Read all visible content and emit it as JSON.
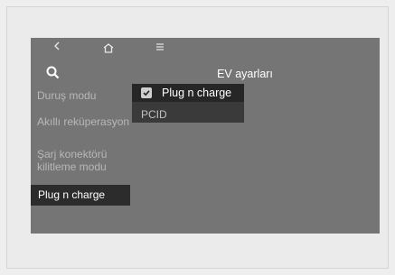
{
  "header": {
    "title": "EV ayarları"
  },
  "nav": {
    "icons": [
      "back-icon",
      "home-icon",
      "menu-icon",
      "search-icon"
    ]
  },
  "sidebar": {
    "items": [
      {
        "label": "Duruş modu",
        "selected": false
      },
      {
        "label": "Akıllı reküperasyon",
        "selected": false
      },
      {
        "label": "Şarj konektörü kilitleme modu",
        "selected": false
      },
      {
        "label": "Plug n charge",
        "selected": true
      }
    ]
  },
  "popup": {
    "checkbox_label": "Plug n charge",
    "checked": true,
    "pcid_label": "PCID"
  },
  "colors": {
    "screen_bg": "#757575",
    "selected_bg": "#2c2c2c",
    "popup_bg": "#3a3a3a"
  }
}
